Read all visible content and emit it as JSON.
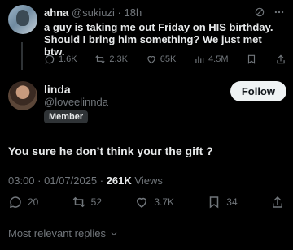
{
  "quoted_post": {
    "name": "ahna",
    "handle": "@sukiuzi",
    "separator": "·",
    "time": "18h",
    "text": "a guy is taking me out Friday on HIS birthday. Should I bring him something? We just met btw.",
    "stats": {
      "replies": "1.6K",
      "reposts": "2.3K",
      "likes": "65K",
      "views": "4.5M"
    }
  },
  "post": {
    "name": "linda",
    "handle": "@loveelinnda",
    "badge": "Member",
    "follow_label": "Follow",
    "text": "You sure he don’t think your the gift ?",
    "timestamp": "03:00 · 01/07/2025 · ",
    "views_count": "261K",
    "views_label": " Views",
    "stats": {
      "replies": "20",
      "reposts": "52",
      "likes": "3.7K",
      "bookmarks": "34"
    }
  },
  "replies_sort_label": "Most relevant replies",
  "colors": {
    "background": "#000000",
    "text": "#e7e9ea",
    "muted": "#71767b",
    "follow_bg": "#eff3f4"
  }
}
